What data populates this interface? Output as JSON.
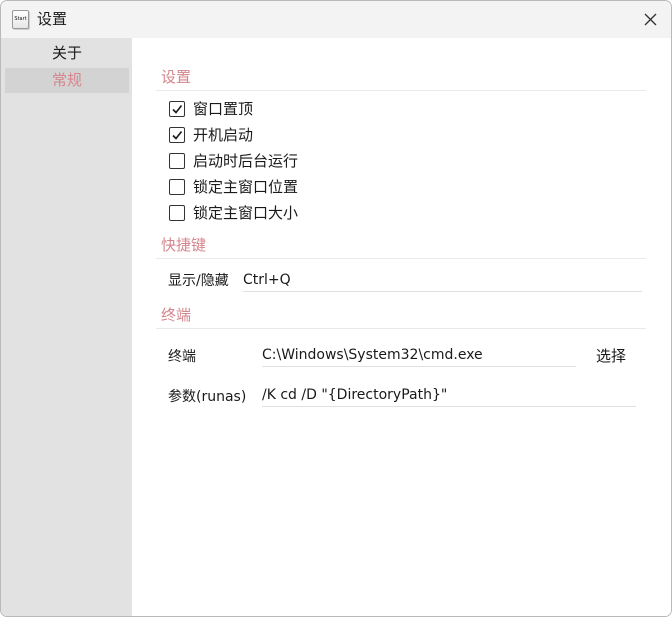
{
  "window": {
    "title": "设置",
    "icon_text": "Start"
  },
  "sidebar": {
    "items": [
      {
        "label": "关于",
        "selected": false
      },
      {
        "label": "常规",
        "selected": true
      }
    ]
  },
  "settings": {
    "section_title": "设置",
    "options": [
      {
        "label": "窗口置顶",
        "checked": true
      },
      {
        "label": "开机启动",
        "checked": true
      },
      {
        "label": "启动时后台运行",
        "checked": false
      },
      {
        "label": "锁定主窗口位置",
        "checked": false
      },
      {
        "label": "锁定主窗口大小",
        "checked": false
      }
    ]
  },
  "hotkey": {
    "section_title": "快捷键",
    "label": "显示/隐藏",
    "value": "Ctrl+Q"
  },
  "terminal": {
    "section_title": "终端",
    "path_label": "终端",
    "path_value": "C:\\Windows\\System32\\cmd.exe",
    "browse_label": "选择",
    "args_label": "参数(runas)",
    "args_value": "/K cd /D \"{DirectoryPath}\""
  },
  "colors": {
    "accent": "#d4868c",
    "sidebar_bg": "#e2e2e2",
    "sidebar_selected_bg": "#d3d3d3",
    "titlebar_bg": "#f3f3f3"
  },
  "icons": {
    "close": "close-icon",
    "app": "app-icon",
    "check": "checkmark-icon"
  }
}
